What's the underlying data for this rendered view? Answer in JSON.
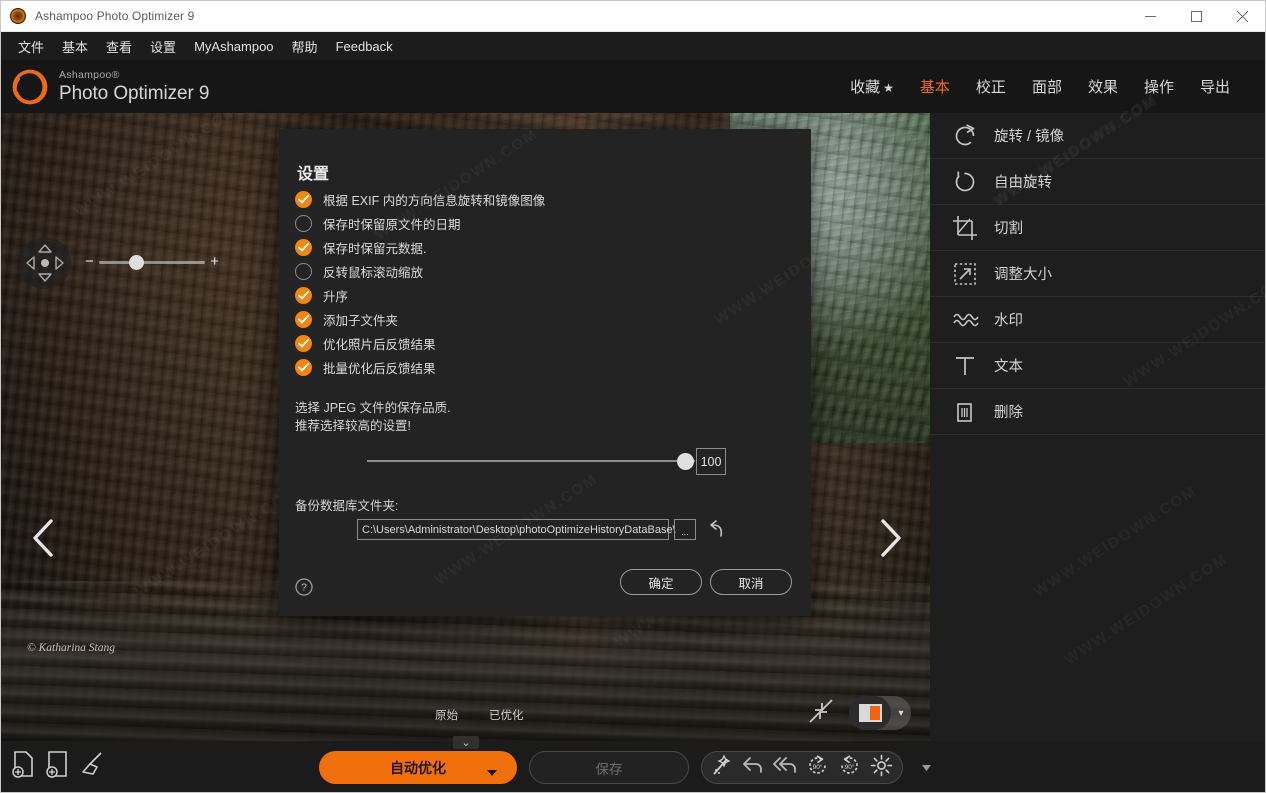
{
  "window": {
    "title": "Ashampoo Photo Optimizer 9",
    "app_icon": "app-aperture-icon",
    "minimize": "–",
    "maximize": "□",
    "close": "✕"
  },
  "menubar": {
    "items": [
      {
        "label": "文件"
      },
      {
        "label": "基本"
      },
      {
        "label": "查看"
      },
      {
        "label": "设置"
      },
      {
        "label": "MyAshampoo"
      },
      {
        "label": "帮助"
      },
      {
        "label": "Feedback"
      }
    ]
  },
  "brand": {
    "sub": "Ashampoo®",
    "main": "Photo Optimizer 9"
  },
  "topnav": {
    "items": [
      {
        "label": "收藏",
        "star": "★",
        "active": false
      },
      {
        "label": "基本",
        "active": true
      },
      {
        "label": "校正",
        "active": false
      },
      {
        "label": "面部",
        "active": false
      },
      {
        "label": "效果",
        "active": false
      },
      {
        "label": "操作",
        "active": false
      },
      {
        "label": "导出",
        "active": false
      }
    ]
  },
  "canvas": {
    "zoom_minus": "−",
    "zoom_plus": "+",
    "copyright": "© Katharina Stang",
    "compare_original": "原始",
    "compare_optimized": "已优化",
    "pan_icon": "pan-move-icon",
    "prev_icon": "chevron-left-icon",
    "next_icon": "chevron-right-icon",
    "collapse_icon": "collapse-arrows-icon",
    "viewmode_icon": "split-view-icon",
    "viewmode_caret": "▾"
  },
  "sidebar": {
    "items": [
      {
        "label": "旋转 / 镜像",
        "icon": "rotate-mirror-icon"
      },
      {
        "label": "自由旋转",
        "icon": "free-rotate-icon"
      },
      {
        "label": "切割",
        "icon": "crop-icon"
      },
      {
        "label": "调整大小",
        "icon": "resize-icon"
      },
      {
        "label": "水印",
        "icon": "watermark-icon"
      },
      {
        "label": "文本",
        "icon": "text-icon"
      },
      {
        "label": "删除",
        "icon": "trash-icon"
      }
    ]
  },
  "bottombar": {
    "left_icons": [
      {
        "name": "add-file-icon"
      },
      {
        "name": "add-folder-icon"
      },
      {
        "name": "broom-clear-icon"
      }
    ],
    "auto_optimize": "自动优化",
    "auto_caret": "▾",
    "save": "保存",
    "tools": [
      {
        "name": "magic-wand-icon"
      },
      {
        "name": "undo-icon"
      },
      {
        "name": "undo-all-icon"
      },
      {
        "name": "rotate-left-90-icon"
      },
      {
        "name": "rotate-right-90-icon"
      },
      {
        "name": "gear-settings-icon"
      }
    ],
    "tool_caret": "▾",
    "panel_toggle_caret": "⌄"
  },
  "dialog": {
    "title": "设置",
    "checkboxes": [
      {
        "label": "根据 EXIF 内的方向信息旋转和镜像图像",
        "checked": true
      },
      {
        "label": "保存时保留原文件的日期",
        "checked": false
      },
      {
        "label": "保存时保留元数据.",
        "checked": true
      },
      {
        "label": "反转鼠标滚动缩放",
        "checked": false
      },
      {
        "label": "升序",
        "checked": true
      },
      {
        "label": "添加子文件夹",
        "checked": true
      },
      {
        "label": "优化照片后反馈结果",
        "checked": true
      },
      {
        "label": "批量优化后反馈结果",
        "checked": true
      }
    ],
    "jpeg_note_line1": "选择 JPEG 文件的保存品质.",
    "jpeg_note_line2": "推荐选择较高的设置!",
    "quality_value": "100",
    "backup_label": "备份数据库文件夹:",
    "backup_path": "C:\\Users\\Administrator\\Desktop\\photoOptimizeHistoryDataBase\\",
    "browse_label": "...",
    "reset_icon": "reset-undo-icon",
    "help_icon": "help-question-icon",
    "ok": "确定",
    "cancel": "取消"
  },
  "watermarks": [
    {
      "text": "WWW.WEIDOWN.COM"
    }
  ],
  "colors": {
    "accent_orange": "#f2700b",
    "checkbox_orange": "#f2860f",
    "panel_dark": "#232323",
    "sidebar_bg": "#1e1e1e",
    "titlebar_bg": "#ffffff"
  }
}
